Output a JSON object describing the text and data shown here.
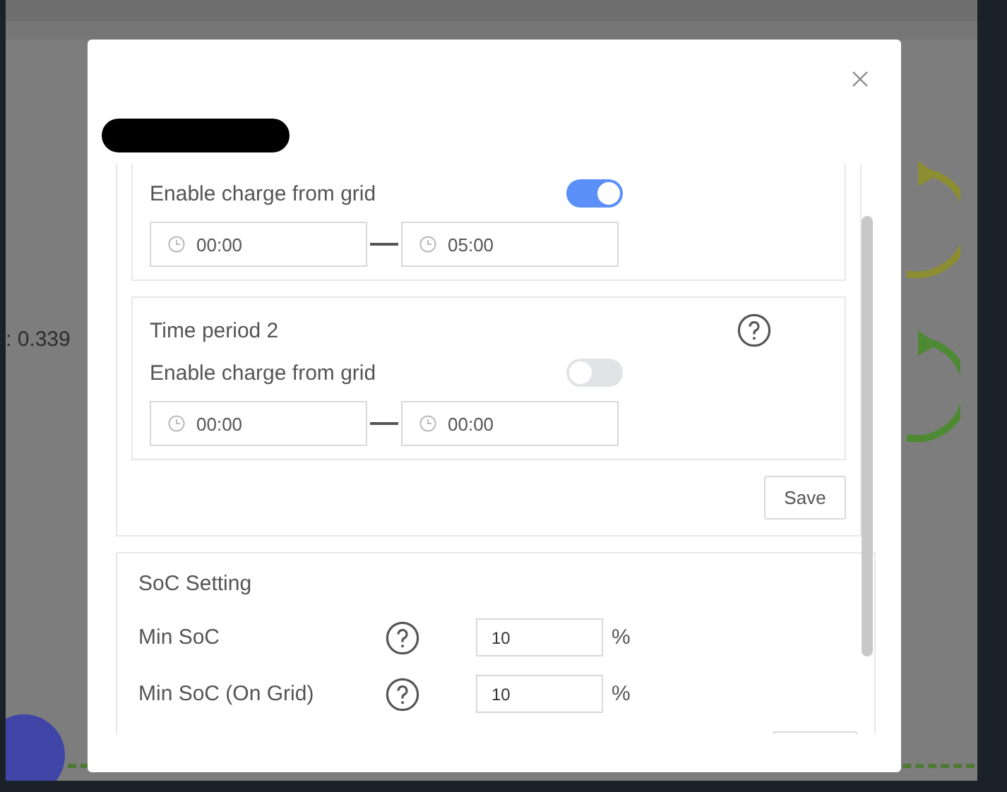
{
  "background": {
    "reading": ": 0.339"
  },
  "dialog": {
    "periods": [
      {
        "enable_label": "Enable charge from grid",
        "enabled": true,
        "start": "00:00",
        "end": "05:00"
      },
      {
        "title": "Time period 2",
        "enable_label": "Enable charge from grid",
        "enabled": false,
        "start": "00:00",
        "end": "00:00"
      }
    ],
    "save_button": "Save",
    "soc": {
      "title": "SoC Setting",
      "fields": [
        {
          "label": "Min SoC",
          "value": "10",
          "unit": "%"
        },
        {
          "label": "Min SoC (On Grid)",
          "value": "10",
          "unit": "%"
        }
      ]
    }
  }
}
